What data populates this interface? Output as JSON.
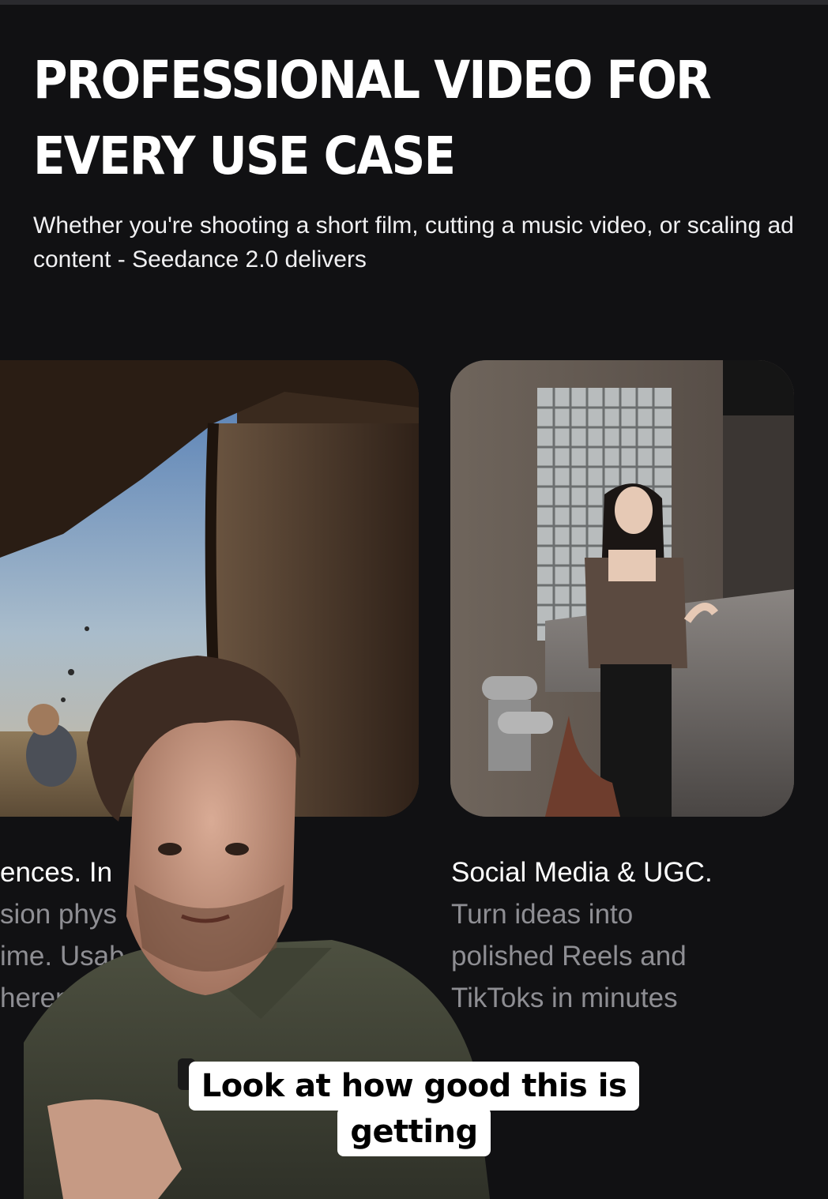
{
  "section": {
    "headline_line1": "PROFESSIONAL VIDEO FOR",
    "headline_line2": "EVERY USE CASE",
    "subtitle": "Whether you're shooting a short film, cutting a music video, or scaling ad content - Seedance 2.0 delivers"
  },
  "cards": [
    {
      "id": "cinematic",
      "image_icon": "cinematic-sky-scene-image",
      "lines": [
        "ences. In",
        "sion phys",
        "ime. Usab",
        "herent"
      ]
    },
    {
      "id": "social",
      "image_icon": "woman-in-cafe-image",
      "title": "Social Media & UGC.",
      "body": "Turn ideas into polished Reels and TikToks in minutes"
    }
  ],
  "caption": {
    "line1": "Look at how good this is",
    "line2": "getting"
  },
  "colors": {
    "background": "#111113",
    "headline": "#ffffff",
    "muted_text": "#8e8e93",
    "caption_bg": "#ffffff"
  }
}
